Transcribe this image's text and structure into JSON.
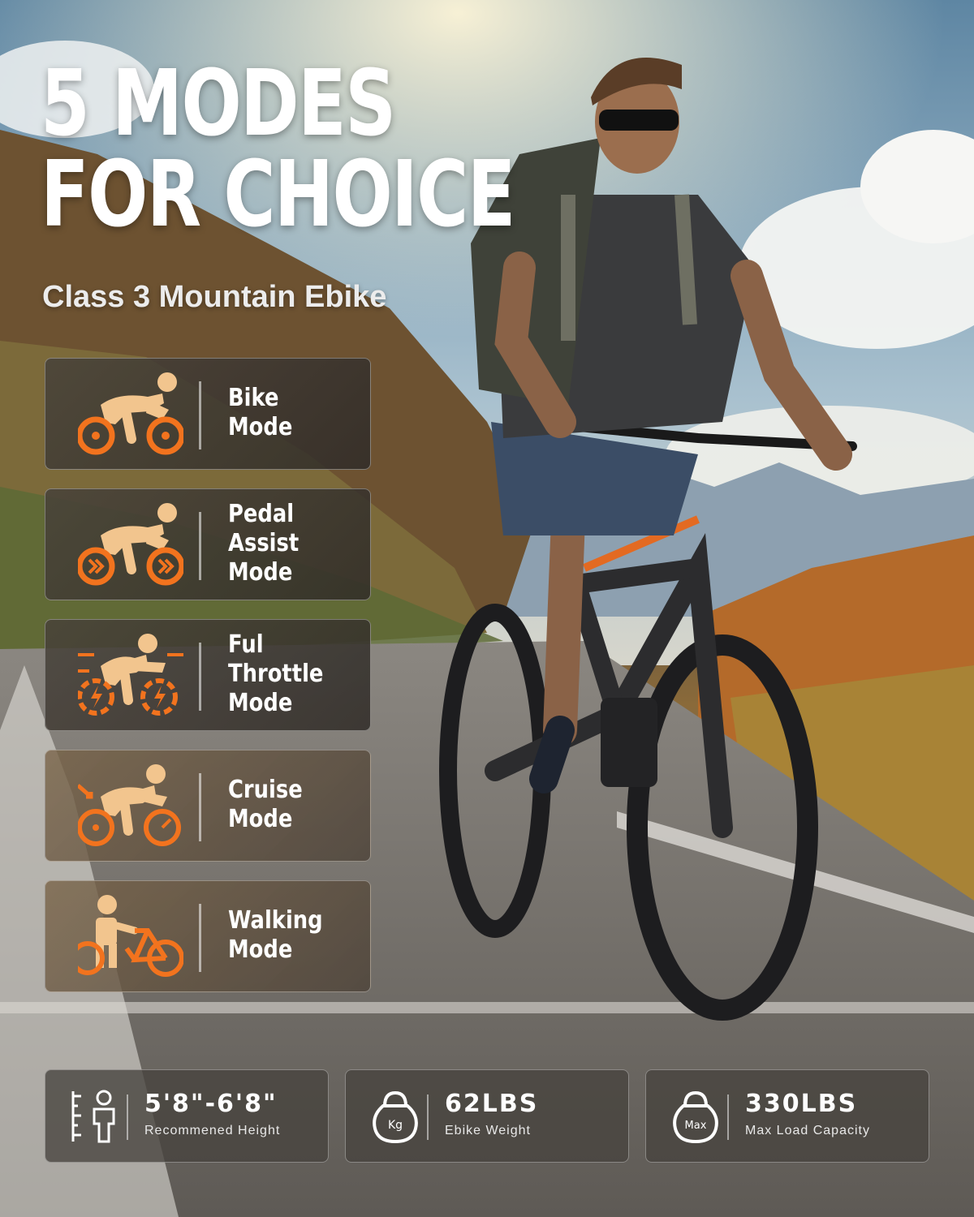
{
  "headline": {
    "line1": "5 MODES",
    "line2": "FOR CHOICE"
  },
  "subtitle": "Class 3 Mountain Ebike",
  "modes": [
    {
      "label": "Bike\nMode",
      "icon": "bike-rider-icon"
    },
    {
      "label": "Pedal\nAssist Mode",
      "icon": "pedal-assist-icon"
    },
    {
      "label": "Ful Throttle\nMode",
      "icon": "throttle-lightning-icon"
    },
    {
      "label": "Cruise\nMode",
      "icon": "cruise-speedometer-icon"
    },
    {
      "label": "Walking\nMode",
      "icon": "walking-bike-icon"
    }
  ],
  "specs": [
    {
      "value": "5'8\"-6'8\"",
      "caption": "Recommened Height",
      "icon": "height-ruler-icon"
    },
    {
      "value": "62LBS",
      "caption": "Ebike Weight",
      "icon": "kettlebell-kg-icon",
      "icon_text": "Kg"
    },
    {
      "value": "330LBS",
      "caption": "Max Load Capacity",
      "icon": "kettlebell-max-icon",
      "icon_text": "Max"
    }
  ],
  "colors": {
    "accent": "#f2731e",
    "skin": "#f2c58e",
    "panel": "#4a443c",
    "text": "#ffffff"
  }
}
